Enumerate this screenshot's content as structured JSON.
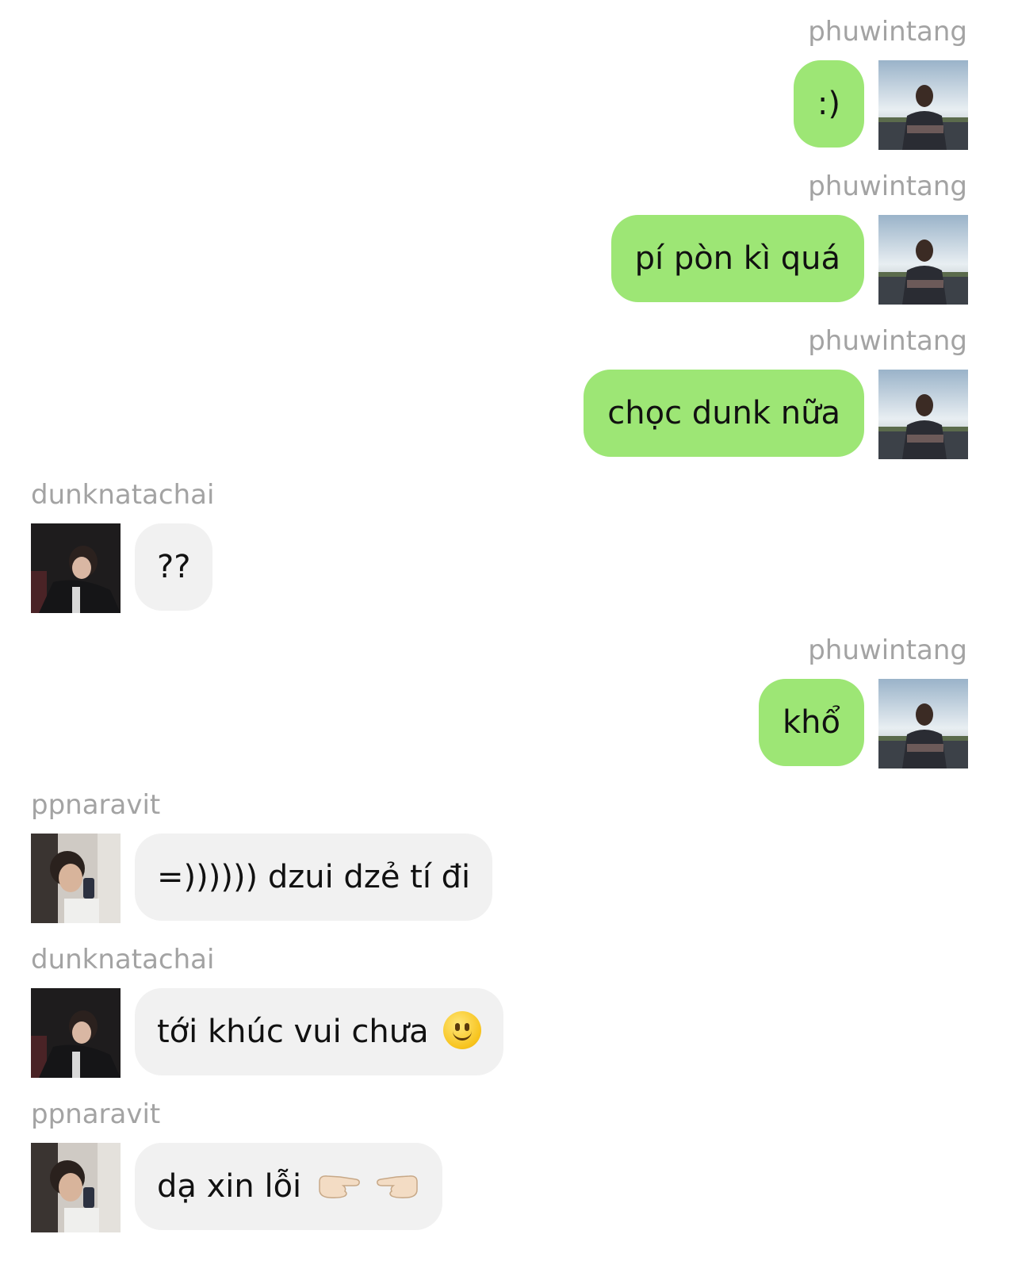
{
  "chat": {
    "messages": [
      {
        "sender": "phuwintang",
        "side": "right",
        "text": ":)"
      },
      {
        "sender": "phuwintang",
        "side": "right",
        "text": "pí pòn kì quá"
      },
      {
        "sender": "phuwintang",
        "side": "right",
        "text": "chọc dunk nữa"
      },
      {
        "sender": "dunknatachai",
        "side": "left",
        "text": "??"
      },
      {
        "sender": "phuwintang",
        "side": "right",
        "text": "khổ"
      },
      {
        "sender": "ppnaravit",
        "side": "left",
        "text": "=)))))) dzui dzẻ tí đi"
      },
      {
        "sender": "dunknatachai",
        "side": "left",
        "text": "tới khúc vui chưa",
        "emoji": "slightly-smiling-face-icon"
      },
      {
        "sender": "ppnaravit",
        "side": "left",
        "text": "dạ xin lỗi",
        "emoji": "pointing-fingers-icon"
      }
    ]
  },
  "colors": {
    "outgoing_bubble": "#9de675",
    "incoming_bubble": "#f1f1f1",
    "username": "#a3a3a3"
  }
}
